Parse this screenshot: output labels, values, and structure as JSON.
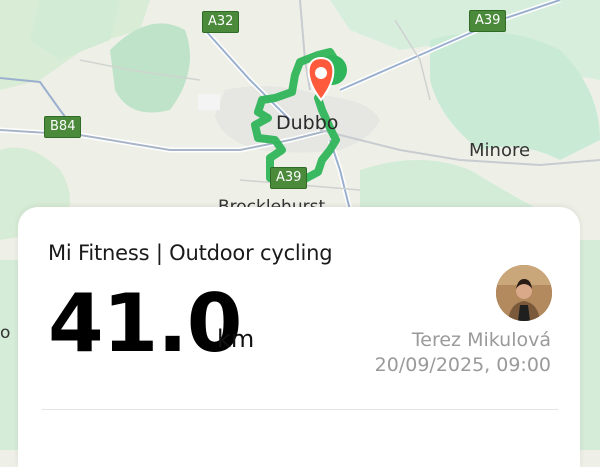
{
  "map": {
    "roads": [
      "A32",
      "A39",
      "B84",
      "A39"
    ],
    "places": {
      "center": "Dubbo",
      "east": "Minore",
      "south_partial": "Brocklehurst",
      "left_edge_partial": "o"
    },
    "colors": {
      "route": "#2fb55a",
      "pin": "#ff5a3c",
      "road_badge": "#4a8a3a"
    }
  },
  "activity": {
    "app_title": "Mi Fitness | Outdoor cycling",
    "distance_value": "41.0",
    "distance_unit": "km",
    "user_name": "Terez Mikulová",
    "timestamp": "20/09/2025, 09:00"
  }
}
